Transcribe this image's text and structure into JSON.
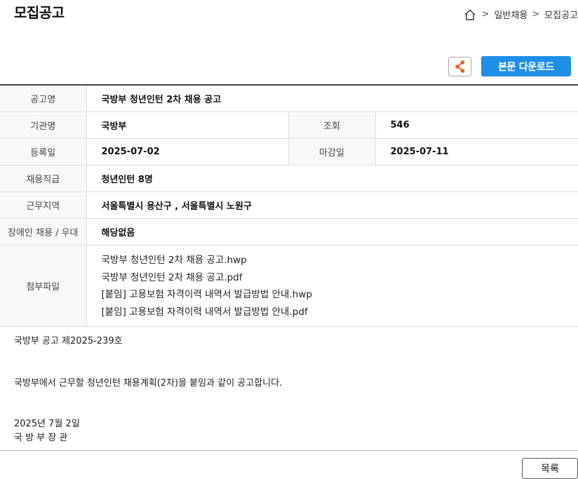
{
  "page": {
    "title": "모집공고"
  },
  "breadcrumb": {
    "separator": ">",
    "items": [
      "일반채용",
      "모집공고"
    ]
  },
  "toolbar": {
    "download_label": "본문 다운로드"
  },
  "info": {
    "title": {
      "label": "공고명",
      "value": "국방부 청년인턴 2차 채용 공고"
    },
    "org": {
      "label": "기관명",
      "value": "국방부"
    },
    "views": {
      "label": "조회",
      "value": "546"
    },
    "reg_date": {
      "label": "등록일",
      "value": "2025-07-02"
    },
    "deadline": {
      "label": "마감일",
      "value": "2025-07-11"
    },
    "position": {
      "label": "채용직급",
      "value": "청년인턴 8명"
    },
    "location": {
      "label": "근무지역",
      "value": "서울특별시 용산구 ,  서울특별시 노원구"
    },
    "disability": {
      "label": "장애인 채용 / 우대",
      "value": "해당없음"
    },
    "attachments": {
      "label": "첨부파일",
      "files": [
        "국방부 청년인턴 2차 채용 공고.hwp",
        "국방부 청년인턴 2차 채용 공고.pdf",
        "[붙임] 고용보험 자격이력 내역서 발급방법 안내.hwp",
        "[붙임] 고용보험 자격이력 내역서 발급방법 안내.pdf"
      ]
    }
  },
  "body": {
    "notice_no": "국방부 공고 제2025-239호",
    "content": "국방부에서 근무할 청년인턴 채용계획(2차)을 붙임과 같이 공고합니다.",
    "date": "2025년 7월 2일",
    "signer": "국 방 부 장 관"
  },
  "footer": {
    "list_label": "목록"
  },
  "colors": {
    "accent": "#1f8ee6",
    "share_icon": "#e0621f",
    "header_cell_bg": "#f7f8fa"
  }
}
